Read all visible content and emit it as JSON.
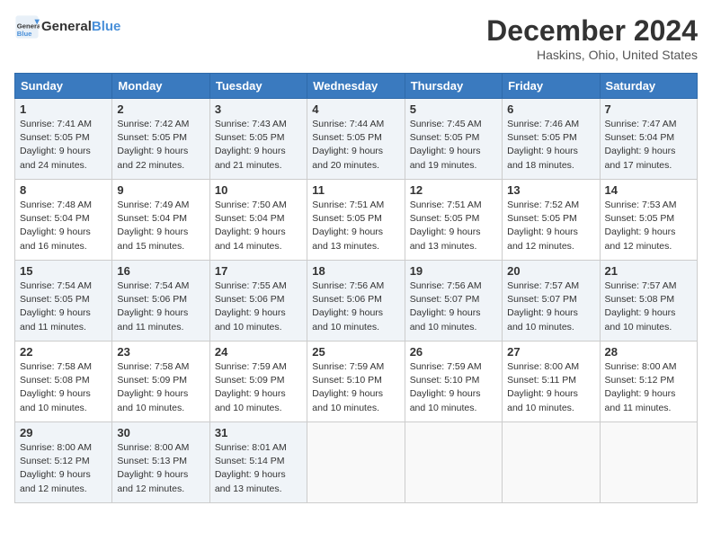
{
  "header": {
    "logo_line1": "General",
    "logo_line2": "Blue",
    "month": "December 2024",
    "location": "Haskins, Ohio, United States"
  },
  "weekdays": [
    "Sunday",
    "Monday",
    "Tuesday",
    "Wednesday",
    "Thursday",
    "Friday",
    "Saturday"
  ],
  "weeks": [
    [
      {
        "day": "1",
        "sunrise": "Sunrise: 7:41 AM",
        "sunset": "Sunset: 5:05 PM",
        "daylight": "Daylight: 9 hours and 24 minutes."
      },
      {
        "day": "2",
        "sunrise": "Sunrise: 7:42 AM",
        "sunset": "Sunset: 5:05 PM",
        "daylight": "Daylight: 9 hours and 22 minutes."
      },
      {
        "day": "3",
        "sunrise": "Sunrise: 7:43 AM",
        "sunset": "Sunset: 5:05 PM",
        "daylight": "Daylight: 9 hours and 21 minutes."
      },
      {
        "day": "4",
        "sunrise": "Sunrise: 7:44 AM",
        "sunset": "Sunset: 5:05 PM",
        "daylight": "Daylight: 9 hours and 20 minutes."
      },
      {
        "day": "5",
        "sunrise": "Sunrise: 7:45 AM",
        "sunset": "Sunset: 5:05 PM",
        "daylight": "Daylight: 9 hours and 19 minutes."
      },
      {
        "day": "6",
        "sunrise": "Sunrise: 7:46 AM",
        "sunset": "Sunset: 5:05 PM",
        "daylight": "Daylight: 9 hours and 18 minutes."
      },
      {
        "day": "7",
        "sunrise": "Sunrise: 7:47 AM",
        "sunset": "Sunset: 5:04 PM",
        "daylight": "Daylight: 9 hours and 17 minutes."
      }
    ],
    [
      {
        "day": "8",
        "sunrise": "Sunrise: 7:48 AM",
        "sunset": "Sunset: 5:04 PM",
        "daylight": "Daylight: 9 hours and 16 minutes."
      },
      {
        "day": "9",
        "sunrise": "Sunrise: 7:49 AM",
        "sunset": "Sunset: 5:04 PM",
        "daylight": "Daylight: 9 hours and 15 minutes."
      },
      {
        "day": "10",
        "sunrise": "Sunrise: 7:50 AM",
        "sunset": "Sunset: 5:04 PM",
        "daylight": "Daylight: 9 hours and 14 minutes."
      },
      {
        "day": "11",
        "sunrise": "Sunrise: 7:51 AM",
        "sunset": "Sunset: 5:05 PM",
        "daylight": "Daylight: 9 hours and 13 minutes."
      },
      {
        "day": "12",
        "sunrise": "Sunrise: 7:51 AM",
        "sunset": "Sunset: 5:05 PM",
        "daylight": "Daylight: 9 hours and 13 minutes."
      },
      {
        "day": "13",
        "sunrise": "Sunrise: 7:52 AM",
        "sunset": "Sunset: 5:05 PM",
        "daylight": "Daylight: 9 hours and 12 minutes."
      },
      {
        "day": "14",
        "sunrise": "Sunrise: 7:53 AM",
        "sunset": "Sunset: 5:05 PM",
        "daylight": "Daylight: 9 hours and 12 minutes."
      }
    ],
    [
      {
        "day": "15",
        "sunrise": "Sunrise: 7:54 AM",
        "sunset": "Sunset: 5:05 PM",
        "daylight": "Daylight: 9 hours and 11 minutes."
      },
      {
        "day": "16",
        "sunrise": "Sunrise: 7:54 AM",
        "sunset": "Sunset: 5:06 PM",
        "daylight": "Daylight: 9 hours and 11 minutes."
      },
      {
        "day": "17",
        "sunrise": "Sunrise: 7:55 AM",
        "sunset": "Sunset: 5:06 PM",
        "daylight": "Daylight: 9 hours and 10 minutes."
      },
      {
        "day": "18",
        "sunrise": "Sunrise: 7:56 AM",
        "sunset": "Sunset: 5:06 PM",
        "daylight": "Daylight: 9 hours and 10 minutes."
      },
      {
        "day": "19",
        "sunrise": "Sunrise: 7:56 AM",
        "sunset": "Sunset: 5:07 PM",
        "daylight": "Daylight: 9 hours and 10 minutes."
      },
      {
        "day": "20",
        "sunrise": "Sunrise: 7:57 AM",
        "sunset": "Sunset: 5:07 PM",
        "daylight": "Daylight: 9 hours and 10 minutes."
      },
      {
        "day": "21",
        "sunrise": "Sunrise: 7:57 AM",
        "sunset": "Sunset: 5:08 PM",
        "daylight": "Daylight: 9 hours and 10 minutes."
      }
    ],
    [
      {
        "day": "22",
        "sunrise": "Sunrise: 7:58 AM",
        "sunset": "Sunset: 5:08 PM",
        "daylight": "Daylight: 9 hours and 10 minutes."
      },
      {
        "day": "23",
        "sunrise": "Sunrise: 7:58 AM",
        "sunset": "Sunset: 5:09 PM",
        "daylight": "Daylight: 9 hours and 10 minutes."
      },
      {
        "day": "24",
        "sunrise": "Sunrise: 7:59 AM",
        "sunset": "Sunset: 5:09 PM",
        "daylight": "Daylight: 9 hours and 10 minutes."
      },
      {
        "day": "25",
        "sunrise": "Sunrise: 7:59 AM",
        "sunset": "Sunset: 5:10 PM",
        "daylight": "Daylight: 9 hours and 10 minutes."
      },
      {
        "day": "26",
        "sunrise": "Sunrise: 7:59 AM",
        "sunset": "Sunset: 5:10 PM",
        "daylight": "Daylight: 9 hours and 10 minutes."
      },
      {
        "day": "27",
        "sunrise": "Sunrise: 8:00 AM",
        "sunset": "Sunset: 5:11 PM",
        "daylight": "Daylight: 9 hours and 10 minutes."
      },
      {
        "day": "28",
        "sunrise": "Sunrise: 8:00 AM",
        "sunset": "Sunset: 5:12 PM",
        "daylight": "Daylight: 9 hours and 11 minutes."
      }
    ],
    [
      {
        "day": "29",
        "sunrise": "Sunrise: 8:00 AM",
        "sunset": "Sunset: 5:12 PM",
        "daylight": "Daylight: 9 hours and 12 minutes."
      },
      {
        "day": "30",
        "sunrise": "Sunrise: 8:00 AM",
        "sunset": "Sunset: 5:13 PM",
        "daylight": "Daylight: 9 hours and 12 minutes."
      },
      {
        "day": "31",
        "sunrise": "Sunrise: 8:01 AM",
        "sunset": "Sunset: 5:14 PM",
        "daylight": "Daylight: 9 hours and 13 minutes."
      },
      null,
      null,
      null,
      null
    ]
  ]
}
